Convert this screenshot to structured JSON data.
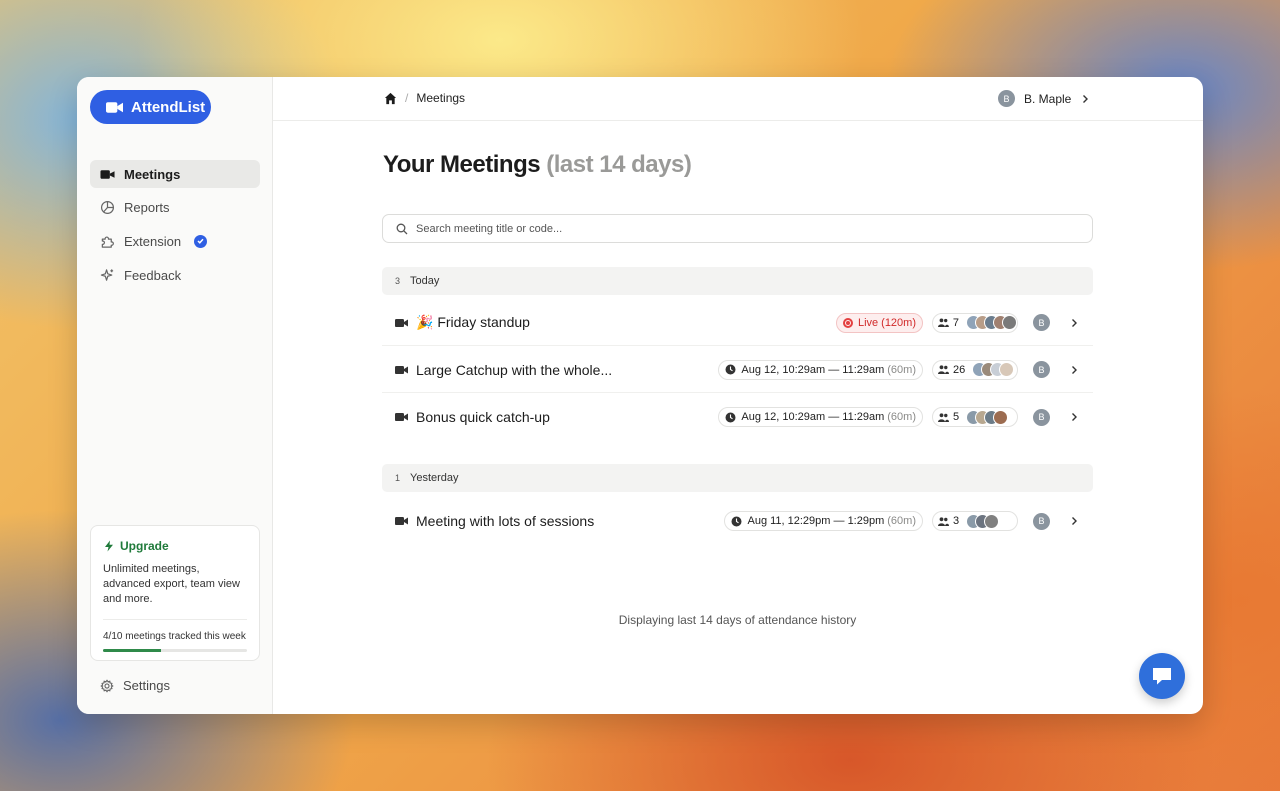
{
  "brand": {
    "name": "AttendList",
    "color": "#2f5fe3"
  },
  "sidebar": {
    "items": [
      {
        "label": "Meetings",
        "icon": "video-camera-icon",
        "active": true
      },
      {
        "label": "Reports",
        "icon": "pie-chart-icon"
      },
      {
        "label": "Extension",
        "icon": "puzzle-piece-icon",
        "badge": "verified-icon"
      },
      {
        "label": "Feedback",
        "icon": "sparkle-icon"
      }
    ],
    "upgrade": {
      "title": "Upgrade",
      "description": "Unlimited meetings, advanced export, team view and more.",
      "usage": "4/10 meetings tracked this week",
      "progress": 0.4
    },
    "settings_label": "Settings"
  },
  "header": {
    "breadcrumb": {
      "current": "Meetings"
    },
    "user": {
      "initial": "B",
      "name": "B. Maple"
    }
  },
  "main": {
    "title": "Your Meetings",
    "title_muted": "(last 14 days)",
    "search_placeholder": "Search meeting title or code...",
    "groups": [
      {
        "count": "3",
        "label": "Today",
        "meetings": [
          {
            "title": "🎉 Friday standup",
            "live": true,
            "live_label": "Live",
            "duration": "(120m)",
            "attendees": "7",
            "host_initial": "B"
          },
          {
            "title": "Large Catchup with the whole...",
            "live": false,
            "time": "Aug 12, 10:29am — 11:29am",
            "duration": "(60m)",
            "attendees": "26",
            "host_initial": "B"
          },
          {
            "title": "Bonus quick catch-up",
            "live": false,
            "time": "Aug 12, 10:29am — 11:29am",
            "duration": "(60m)",
            "attendees": "5",
            "host_initial": "B"
          }
        ]
      },
      {
        "count": "1",
        "label": "Yesterday",
        "meetings": [
          {
            "title": "Meeting with lots of sessions",
            "live": false,
            "time": "Aug 11, 12:29pm — 1:29pm",
            "duration": "(60m)",
            "attendees": "3",
            "host_initial": "B"
          }
        ]
      }
    ],
    "footer_note": "Displaying last 14 days of attendance history"
  },
  "colors": {
    "accent": "#2f5fe3",
    "live": "#d12a2a",
    "upgrade": "#1f7a3a"
  }
}
